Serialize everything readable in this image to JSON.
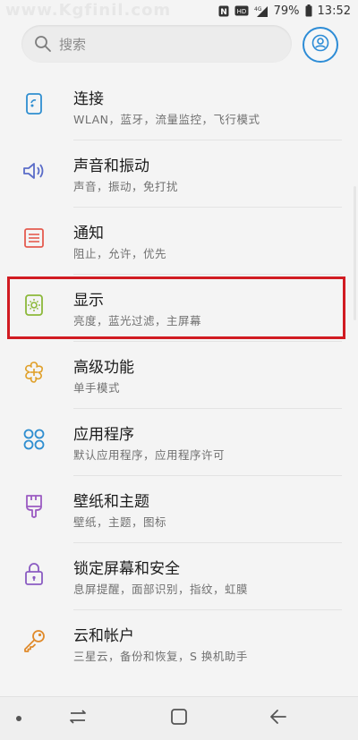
{
  "status": {
    "watermark": "www.Kgfinil.com",
    "battery": "79%",
    "time": "13:52"
  },
  "search": {
    "placeholder": "搜索"
  },
  "menu": [
    {
      "title": "连接",
      "subtitle": "WLAN，蓝牙，流量监控，飞行模式",
      "icon": "connections-icon"
    },
    {
      "title": "声音和振动",
      "subtitle": "声音，振动，免打扰",
      "icon": "sound-icon"
    },
    {
      "title": "通知",
      "subtitle": "阻止，允许，优先",
      "icon": "notifications-icon"
    },
    {
      "title": "显示",
      "subtitle": "亮度，蓝光过滤，主屏幕",
      "icon": "display-icon"
    },
    {
      "title": "高级功能",
      "subtitle": "单手模式",
      "icon": "advanced-features-icon"
    },
    {
      "title": "应用程序",
      "subtitle": "默认应用程序，应用程序许可",
      "icon": "apps-icon"
    },
    {
      "title": "壁纸和主题",
      "subtitle": "壁纸，主题，图标",
      "icon": "wallpaper-icon"
    },
    {
      "title": "锁定屏幕和安全",
      "subtitle": "息屏提醒，面部识别，指纹，虹膜",
      "icon": "lock-icon"
    },
    {
      "title": "云和帐户",
      "subtitle": "三星云，备份和恢复，S 换机助手",
      "icon": "key-icon"
    }
  ],
  "colors": {
    "accent": "#2d8cd6",
    "highlight_frame": "#d11b22"
  }
}
